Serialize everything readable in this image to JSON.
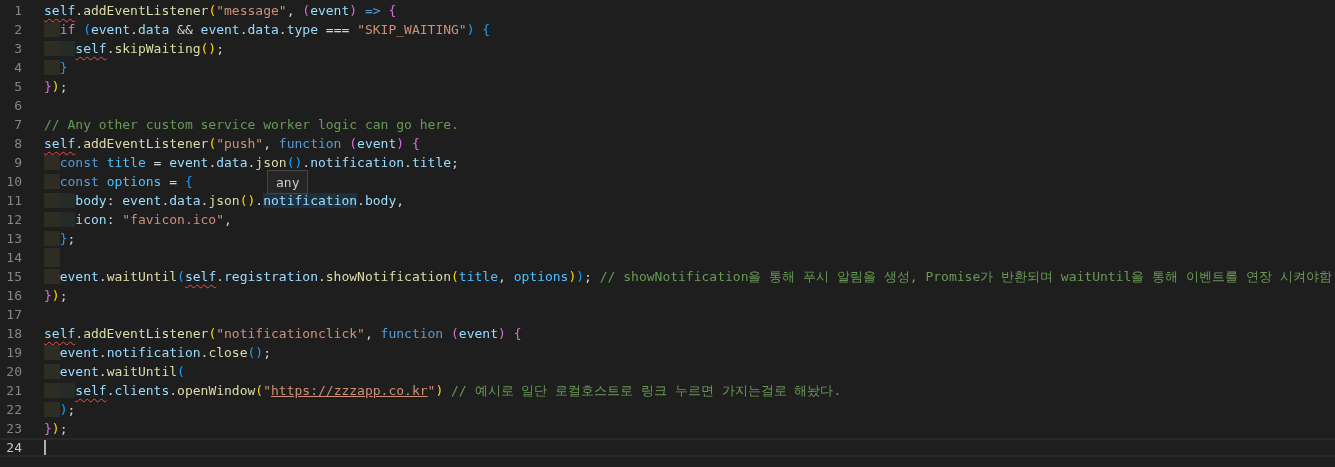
{
  "editor": {
    "lines": [
      {
        "number": "1",
        "current": false,
        "tokens": [
          {
            "kind": "var",
            "text": "self",
            "error": true
          },
          {
            "kind": "punct",
            "text": "."
          },
          {
            "kind": "fn",
            "text": "addEventListener"
          },
          {
            "kind": "b1",
            "text": "("
          },
          {
            "kind": "str",
            "text": "\"message\""
          },
          {
            "kind": "punct",
            "text": ", "
          },
          {
            "kind": "b2",
            "text": "("
          },
          {
            "kind": "var",
            "text": "event"
          },
          {
            "kind": "b2",
            "text": ")"
          },
          {
            "kind": "kw",
            "text": " => "
          },
          {
            "kind": "b2",
            "text": "{"
          }
        ]
      },
      {
        "number": "2",
        "current": false,
        "tokens": [
          {
            "kind": "ctl",
            "text": "  if "
          },
          {
            "kind": "b3",
            "text": "("
          },
          {
            "kind": "var",
            "text": "event"
          },
          {
            "kind": "punct",
            "text": "."
          },
          {
            "kind": "var",
            "text": "data"
          },
          {
            "kind": "punct",
            "text": " && "
          },
          {
            "kind": "var",
            "text": "event"
          },
          {
            "kind": "punct",
            "text": "."
          },
          {
            "kind": "var",
            "text": "data"
          },
          {
            "kind": "punct",
            "text": "."
          },
          {
            "kind": "var",
            "text": "type"
          },
          {
            "kind": "punct",
            "text": " === "
          },
          {
            "kind": "str",
            "text": "\"SKIP_WAITING\""
          },
          {
            "kind": "b3",
            "text": ") {"
          }
        ]
      },
      {
        "number": "3",
        "current": false,
        "tokens": [
          {
            "kind": "var",
            "text": "    self",
            "error": true
          },
          {
            "kind": "punct",
            "text": "."
          },
          {
            "kind": "fn",
            "text": "skipWaiting"
          },
          {
            "kind": "b1",
            "text": "()"
          },
          {
            "kind": "punct",
            "text": ";"
          }
        ]
      },
      {
        "number": "4",
        "current": false,
        "tokens": [
          {
            "kind": "b3",
            "text": "  }"
          }
        ]
      },
      {
        "number": "5",
        "current": false,
        "tokens": [
          {
            "kind": "b2",
            "text": "}"
          },
          {
            "kind": "b1",
            "text": ")"
          },
          {
            "kind": "punct",
            "text": ";"
          }
        ]
      },
      {
        "number": "6",
        "current": false
      },
      {
        "number": "7",
        "current": false,
        "tokens": [
          {
            "kind": "cmt",
            "text": "// Any other custom service worker logic can go here."
          }
        ]
      },
      {
        "number": "8",
        "current": false,
        "tokens": [
          {
            "kind": "var",
            "text": "self",
            "error": true
          },
          {
            "kind": "punct",
            "text": "."
          },
          {
            "kind": "fn",
            "text": "addEventListener"
          },
          {
            "kind": "b1",
            "text": "("
          },
          {
            "kind": "str",
            "text": "\"push\""
          },
          {
            "kind": "punct",
            "text": ", "
          },
          {
            "kind": "kw",
            "text": "function "
          },
          {
            "kind": "b2",
            "text": "("
          },
          {
            "kind": "var",
            "text": "event"
          },
          {
            "kind": "b2",
            "text": ") {"
          }
        ]
      },
      {
        "number": "9",
        "current": false,
        "tokens": [
          {
            "kind": "kw",
            "text": "  const "
          },
          {
            "kind": "const",
            "text": "title"
          },
          {
            "kind": "punct",
            "text": " = "
          },
          {
            "kind": "var",
            "text": "event"
          },
          {
            "kind": "punct",
            "text": "."
          },
          {
            "kind": "var",
            "text": "data"
          },
          {
            "kind": "punct",
            "text": "."
          },
          {
            "kind": "fn",
            "text": "json"
          },
          {
            "kind": "b3",
            "text": "()"
          },
          {
            "kind": "punct",
            "text": "."
          },
          {
            "kind": "var",
            "text": "notification"
          },
          {
            "kind": "punct",
            "text": "."
          },
          {
            "kind": "var",
            "text": "title"
          },
          {
            "kind": "punct",
            "text": ";"
          }
        ]
      },
      {
        "number": "10",
        "current": false,
        "tokens": [
          {
            "kind": "kw",
            "text": "  const "
          },
          {
            "kind": "const",
            "text": "options"
          },
          {
            "kind": "punct",
            "text": " = "
          },
          {
            "kind": "b3",
            "text": "{"
          }
        ]
      },
      {
        "number": "11",
        "current": false,
        "tokens": [
          {
            "kind": "var",
            "text": "    body"
          },
          {
            "kind": "punct",
            "text": ": "
          },
          {
            "kind": "var",
            "text": "event"
          },
          {
            "kind": "punct",
            "text": "."
          },
          {
            "kind": "var",
            "text": "data"
          },
          {
            "kind": "punct",
            "text": "."
          },
          {
            "kind": "fn",
            "text": "json"
          },
          {
            "kind": "b1",
            "text": "()"
          },
          {
            "kind": "punct",
            "text": "."
          },
          {
            "kind": "var",
            "text": "notification",
            "highlighted": true
          },
          {
            "kind": "punct",
            "text": "."
          },
          {
            "kind": "var",
            "text": "body"
          },
          {
            "kind": "punct",
            "text": ","
          }
        ]
      },
      {
        "number": "12",
        "current": false,
        "tokens": [
          {
            "kind": "var",
            "text": "    icon"
          },
          {
            "kind": "punct",
            "text": ": "
          },
          {
            "kind": "str",
            "text": "\"favicon.ico\""
          },
          {
            "kind": "punct",
            "text": ","
          }
        ]
      },
      {
        "number": "13",
        "current": false,
        "tokens": [
          {
            "kind": "b3",
            "text": "  }"
          },
          {
            "kind": "punct",
            "text": ";"
          }
        ]
      },
      {
        "number": "14",
        "current": false,
        "guide": true
      },
      {
        "number": "15",
        "current": false,
        "tokens": [
          {
            "kind": "var",
            "text": "  event"
          },
          {
            "kind": "punct",
            "text": "."
          },
          {
            "kind": "fn",
            "text": "waitUntil"
          },
          {
            "kind": "b3",
            "text": "("
          },
          {
            "kind": "var",
            "text": "self",
            "error": true
          },
          {
            "kind": "punct",
            "text": "."
          },
          {
            "kind": "var",
            "text": "registration"
          },
          {
            "kind": "punct",
            "text": "."
          },
          {
            "kind": "fn",
            "text": "showNotification"
          },
          {
            "kind": "b1",
            "text": "("
          },
          {
            "kind": "const",
            "text": "title"
          },
          {
            "kind": "punct",
            "text": ", "
          },
          {
            "kind": "const",
            "text": "options"
          },
          {
            "kind": "b1",
            "text": ")"
          },
          {
            "kind": "b3",
            "text": ")"
          },
          {
            "kind": "punct",
            "text": "; "
          },
          {
            "kind": "cmt",
            "text": "// showNotification을 통해 푸시 알림을 생성, Promise가 반환되며 waitUntil을 통해 이벤트를 연장 시켜야함"
          }
        ]
      },
      {
        "number": "16",
        "current": false,
        "tokens": [
          {
            "kind": "b2",
            "text": "}"
          },
          {
            "kind": "b1",
            "text": ")"
          },
          {
            "kind": "punct",
            "text": ";"
          }
        ]
      },
      {
        "number": "17",
        "current": false
      },
      {
        "number": "18",
        "current": false,
        "tokens": [
          {
            "kind": "var",
            "text": "self",
            "error": true
          },
          {
            "kind": "punct",
            "text": "."
          },
          {
            "kind": "fn",
            "text": "addEventListener"
          },
          {
            "kind": "b1",
            "text": "("
          },
          {
            "kind": "str",
            "text": "\"notificationclick\""
          },
          {
            "kind": "punct",
            "text": ", "
          },
          {
            "kind": "kw",
            "text": "function "
          },
          {
            "kind": "b2",
            "text": "("
          },
          {
            "kind": "var",
            "text": "event"
          },
          {
            "kind": "b2",
            "text": ") {"
          }
        ]
      },
      {
        "number": "19",
        "current": false,
        "tokens": [
          {
            "kind": "var",
            "text": "  event"
          },
          {
            "kind": "punct",
            "text": "."
          },
          {
            "kind": "var",
            "text": "notification"
          },
          {
            "kind": "punct",
            "text": "."
          },
          {
            "kind": "fn",
            "text": "close"
          },
          {
            "kind": "b3",
            "text": "()"
          },
          {
            "kind": "punct",
            "text": ";"
          }
        ]
      },
      {
        "number": "20",
        "current": false,
        "tokens": [
          {
            "kind": "var",
            "text": "  event"
          },
          {
            "kind": "punct",
            "text": "."
          },
          {
            "kind": "fn",
            "text": "waitUntil"
          },
          {
            "kind": "b3",
            "text": "("
          }
        ]
      },
      {
        "number": "21",
        "current": false,
        "tokens": [
          {
            "kind": "var",
            "text": "    self",
            "error": true
          },
          {
            "kind": "punct",
            "text": "."
          },
          {
            "kind": "var",
            "text": "clients"
          },
          {
            "kind": "punct",
            "text": "."
          },
          {
            "kind": "fn",
            "text": "openWindow"
          },
          {
            "kind": "b1",
            "text": "("
          },
          {
            "kind": "str",
            "text": "\""
          },
          {
            "kind": "link",
            "text": "https://zzzapp.co.kr"
          },
          {
            "kind": "str",
            "text": "\""
          },
          {
            "kind": "b1",
            "text": ")"
          },
          {
            "kind": "cmt",
            "text": " // 예시로 일단 로컬호스트로 링크 누르면 가지는걸로 해놨다."
          }
        ]
      },
      {
        "number": "22",
        "current": false,
        "tokens": [
          {
            "kind": "b3",
            "text": "  )"
          },
          {
            "kind": "punct",
            "text": ";"
          }
        ]
      },
      {
        "number": "23",
        "current": false,
        "tokens": [
          {
            "kind": "b2",
            "text": "}"
          },
          {
            "kind": "b1",
            "text": ")"
          },
          {
            "kind": "punct",
            "text": ";"
          }
        ]
      },
      {
        "number": "24",
        "current": true
      }
    ],
    "hover_tooltip": {
      "text": "any"
    }
  }
}
